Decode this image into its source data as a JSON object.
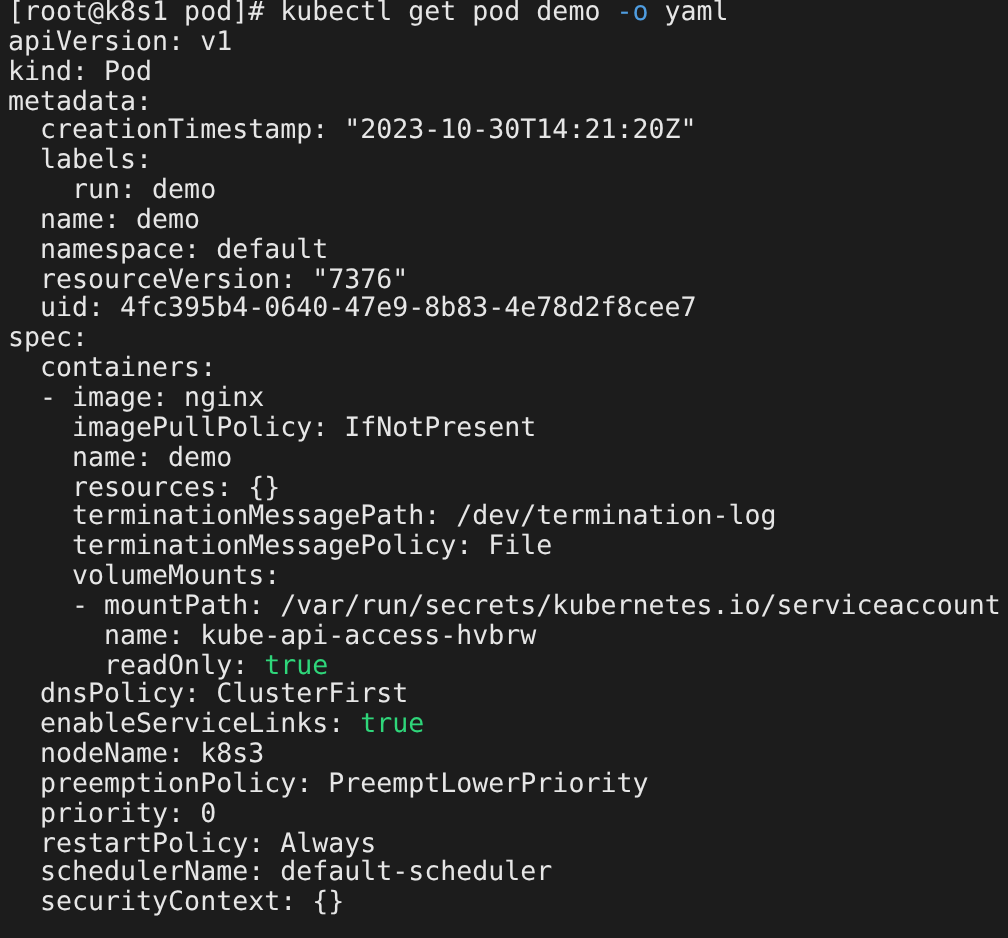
{
  "terminal": {
    "lines": [
      [
        {
          "text": "[root@k8s1 pod]# kubectl get pod demo ",
          "kind": "plain"
        },
        {
          "text": "-o",
          "kind": "option"
        },
        {
          "text": " yaml",
          "kind": "plain"
        }
      ],
      [
        {
          "text": "apiVersion: v1",
          "kind": "plain"
        }
      ],
      [
        {
          "text": "kind: Pod",
          "kind": "plain"
        }
      ],
      [
        {
          "text": "metadata:",
          "kind": "plain"
        }
      ],
      [
        {
          "text": "  creationTimestamp: \"2023-10-30T14:21:20Z\"",
          "kind": "plain"
        }
      ],
      [
        {
          "text": "  labels:",
          "kind": "plain"
        }
      ],
      [
        {
          "text": "    run: demo",
          "kind": "plain"
        }
      ],
      [
        {
          "text": "  name: demo",
          "kind": "plain"
        }
      ],
      [
        {
          "text": "  namespace: default",
          "kind": "plain"
        }
      ],
      [
        {
          "text": "  resourceVersion: \"7376\"",
          "kind": "plain"
        }
      ],
      [
        {
          "text": "  uid: 4fc395b4-0640-47e9-8b83-4e78d2f8cee7",
          "kind": "plain"
        }
      ],
      [
        {
          "text": "spec:",
          "kind": "plain"
        }
      ],
      [
        {
          "text": "  containers:",
          "kind": "plain"
        }
      ],
      [
        {
          "text": "  - image: nginx",
          "kind": "plain"
        }
      ],
      [
        {
          "text": "    imagePullPolicy: IfNotPresent",
          "kind": "plain"
        }
      ],
      [
        {
          "text": "    name: demo",
          "kind": "plain"
        }
      ],
      [
        {
          "text": "    resources: {}",
          "kind": "plain"
        }
      ],
      [
        {
          "text": "    terminationMessagePath: /dev/termination-log",
          "kind": "plain"
        }
      ],
      [
        {
          "text": "    terminationMessagePolicy: File",
          "kind": "plain"
        }
      ],
      [
        {
          "text": "    volumeMounts:",
          "kind": "plain"
        }
      ],
      [
        {
          "text": "    - mountPath: /var/run/secrets/kubernetes.io/serviceaccount",
          "kind": "plain"
        }
      ],
      [
        {
          "text": "      name: kube-api-access-hvbrw",
          "kind": "plain"
        }
      ],
      [
        {
          "text": "      readOnly: ",
          "kind": "plain"
        },
        {
          "text": "true",
          "kind": "boolean"
        }
      ],
      [
        {
          "text": "  dnsPolicy: ClusterFirst",
          "kind": "plain"
        }
      ],
      [
        {
          "text": "  enableServiceLinks: ",
          "kind": "plain"
        },
        {
          "text": "true",
          "kind": "boolean"
        }
      ],
      [
        {
          "text": "  nodeName: k8s3",
          "kind": "plain"
        }
      ],
      [
        {
          "text": "  preemptionPolicy: PreemptLowerPriority",
          "kind": "plain"
        }
      ],
      [
        {
          "text": "  priority: 0",
          "kind": "plain"
        }
      ],
      [
        {
          "text": "  restartPolicy: Always",
          "kind": "plain"
        }
      ],
      [
        {
          "text": "  schedulerName: default-scheduler",
          "kind": "plain"
        }
      ],
      [
        {
          "text": "  securityContext: {}",
          "kind": "plain"
        }
      ]
    ]
  }
}
